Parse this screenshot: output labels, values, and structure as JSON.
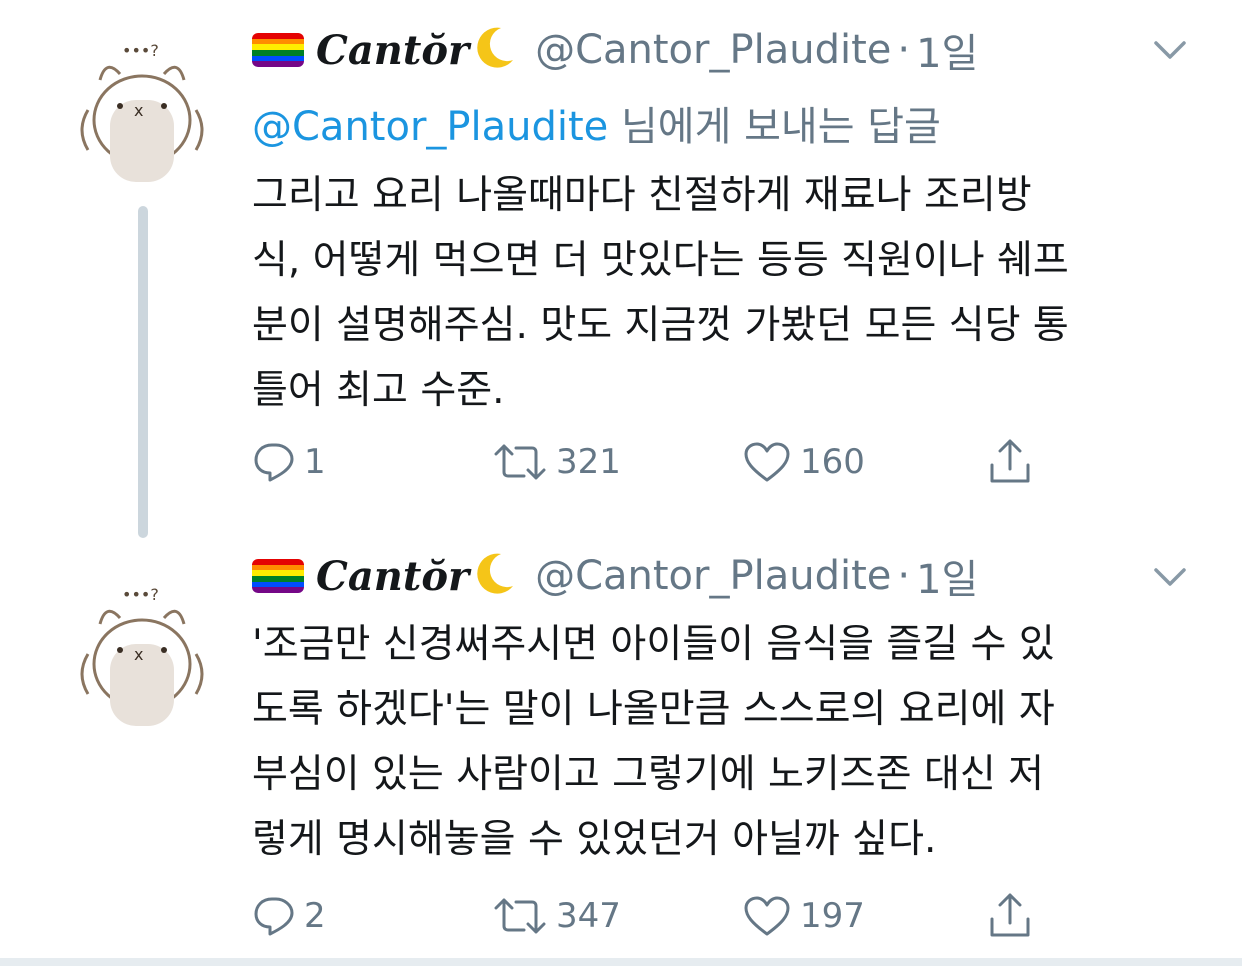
{
  "colors": {
    "link": "#1b95e0",
    "secondary": "#657786",
    "text": "#14171a",
    "divider": "#ccd6dd"
  },
  "tweets": [
    {
      "display_name": "Cantŏr",
      "handle": "@Cantor_Plaudite",
      "separator": "·",
      "time": "1일",
      "reply_mention": "@Cantor_Plaudite",
      "reply_suffix": " 님에게 보내는 답글",
      "body_lines": [
        "그리고 요리 나올때마다 친절하게 재료나 조리방",
        "식, 어떻게 먹으면 더 맛있다는 등등 직원이나 쉐프",
        "분이 설명해주심. 맛도 지금껏 가봤던 모든 식당 통",
        "틀어 최고 수준."
      ],
      "replies": "1",
      "retweets": "321",
      "likes": "160",
      "icons": {
        "reply": "reply-icon",
        "retweet": "retweet-icon",
        "like": "heart-icon",
        "share": "share-icon",
        "more": "chevron-down-icon",
        "flag": "rainbow-flag-icon",
        "moon": "crescent-moon-icon"
      }
    },
    {
      "display_name": "Cantŏr",
      "handle": "@Cantor_Plaudite",
      "separator": "·",
      "time": "1일",
      "body_lines": [
        "'조금만 신경써주시면 아이들이 음식을 즐길 수 있",
        "도록 하겠다'는 말이 나올만큼 스스로의 요리에 자",
        "부심이 있는 사람이고 그렇기에 노키즈존 대신 저",
        "렇게 명시해놓을 수 있었던거 아닐까 싶다."
      ],
      "replies": "2",
      "retweets": "347",
      "likes": "197"
    }
  ]
}
